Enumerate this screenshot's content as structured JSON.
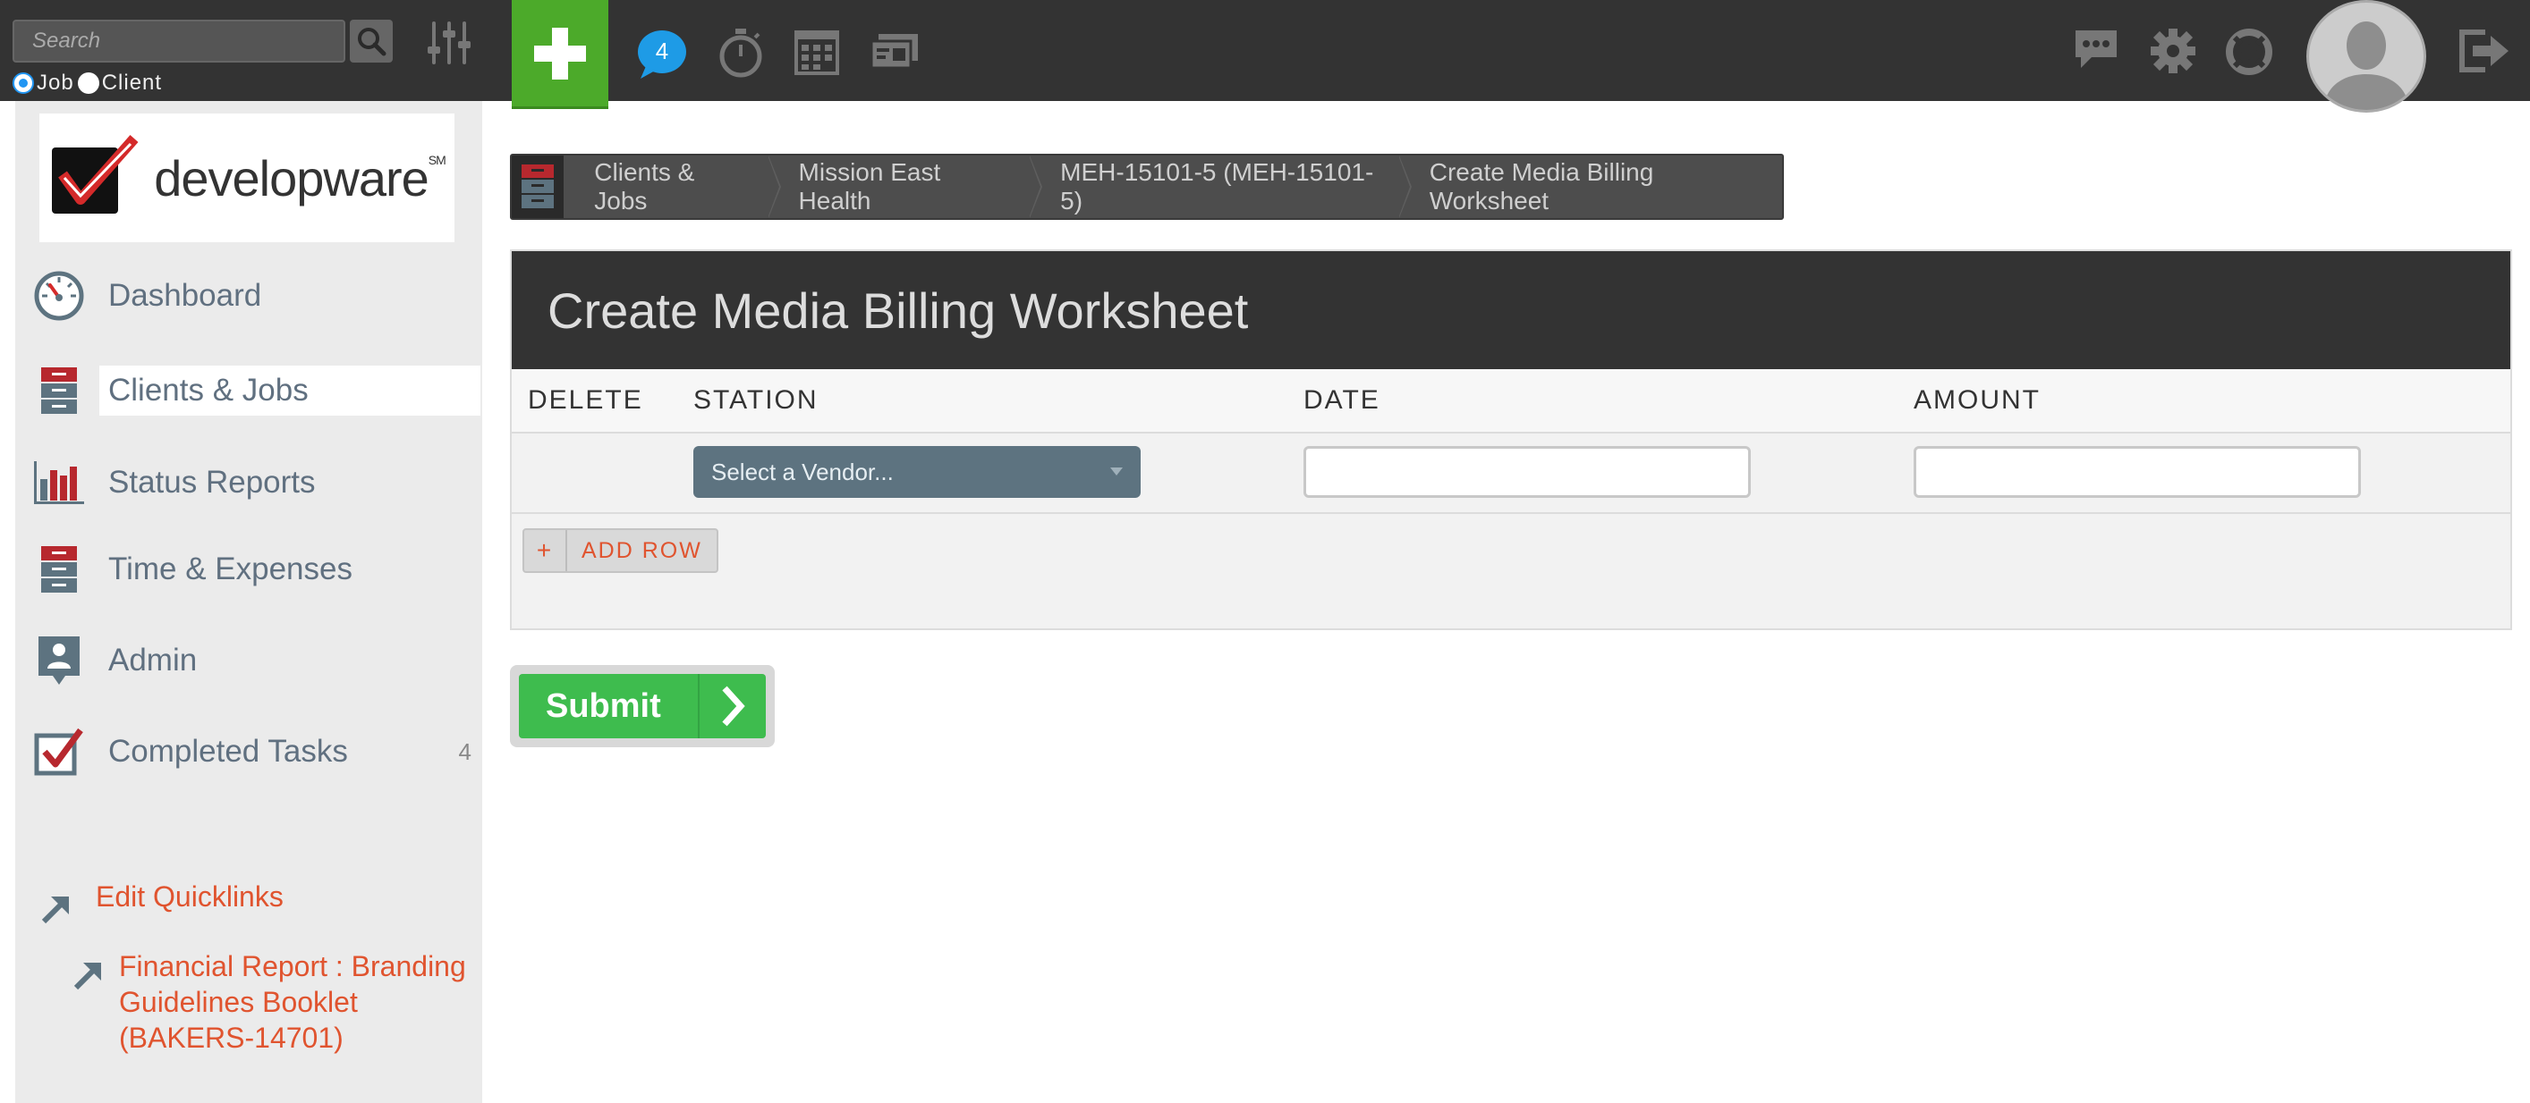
{
  "topbar": {
    "search_placeholder": "Search",
    "radio_options": [
      "Job",
      "Client"
    ],
    "radio_selected": "Job",
    "notification_count": "4",
    "icons": [
      "search-icon",
      "sliders-icon",
      "plus-icon",
      "chat-bubble-icon",
      "stopwatch-icon",
      "calendar-icon",
      "cards-icon",
      "messages-icon",
      "gear-icon",
      "lifebuoy-icon",
      "avatar",
      "logout-icon"
    ]
  },
  "sidebar": {
    "logo_text": "developware",
    "logo_mark": "SM",
    "nav": [
      {
        "label": "Dashboard",
        "icon": "gauge-icon"
      },
      {
        "label": "Clients & Jobs",
        "icon": "file-cabinet-icon",
        "active": true
      },
      {
        "label": "Status Reports",
        "icon": "bar-chart-icon"
      },
      {
        "label": "Time & Expenses",
        "icon": "file-cabinet-icon"
      },
      {
        "label": "Admin",
        "icon": "id-badge-icon"
      },
      {
        "label": "Completed Tasks",
        "icon": "checkbox-icon",
        "count": "4"
      }
    ],
    "quicklinks_edit": "Edit Quicklinks",
    "quicklinks": [
      "Financial Report : Branding Guidelines Booklet (BAKERS-14701)"
    ]
  },
  "breadcrumb": [
    "Clients & Jobs",
    "Mission East Health",
    "MEH-15101-5 (MEH-15101-5)",
    "Create Media Billing Worksheet"
  ],
  "form": {
    "title": "Create Media Billing Worksheet",
    "columns": [
      "DELETE",
      "STATION",
      "DATE",
      "AMOUNT"
    ],
    "vendor_placeholder": "Select a Vendor...",
    "date_value": "",
    "amount_value": "",
    "add_row_plus": "+",
    "add_row_label": "ADD ROW",
    "submit_label": "Submit"
  },
  "colors": {
    "accent_green": "#4caa2a",
    "submit_green": "#3ebc4e",
    "link_orange": "#e0542f",
    "badge_blue": "#1e9be6",
    "dark_bar": "#333333"
  }
}
